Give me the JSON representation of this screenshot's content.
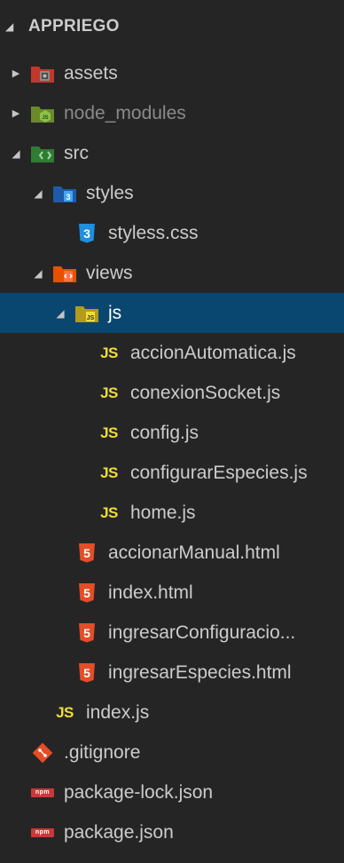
{
  "explorer": {
    "title": "APPRIEGO",
    "items": [
      {
        "label": "assets",
        "icon": "folder-assets-icon",
        "depth": 1,
        "state": "collapsed"
      },
      {
        "label": "node_modules",
        "icon": "folder-node-icon",
        "depth": 1,
        "state": "collapsed",
        "dim": true
      },
      {
        "label": "src",
        "icon": "folder-src-icon",
        "depth": 1,
        "state": "expanded"
      },
      {
        "label": "styles",
        "icon": "folder-styles-icon",
        "depth": 2,
        "state": "expanded"
      },
      {
        "label": "styless.css",
        "icon": "css-file-icon",
        "depth": 3
      },
      {
        "label": "views",
        "icon": "folder-views-icon",
        "depth": 2,
        "state": "expanded"
      },
      {
        "label": "js",
        "icon": "folder-js-icon",
        "depth": 3,
        "state": "expanded",
        "selected": true
      },
      {
        "label": "accionAutomatica.js",
        "icon": "js-file-icon",
        "depth": 4
      },
      {
        "label": "conexionSocket.js",
        "icon": "js-file-icon",
        "depth": 4
      },
      {
        "label": "config.js",
        "icon": "js-file-icon",
        "depth": 4
      },
      {
        "label": "configurarEspecies.js",
        "icon": "js-file-icon",
        "depth": 4
      },
      {
        "label": "home.js",
        "icon": "js-file-icon",
        "depth": 4
      },
      {
        "label": "accionarManual.html",
        "icon": "html-file-icon",
        "depth": 3
      },
      {
        "label": "index.html",
        "icon": "html-file-icon",
        "depth": 3
      },
      {
        "label": "ingresarConfiguracio...",
        "icon": "html-file-icon",
        "depth": 3
      },
      {
        "label": "ingresarEspecies.html",
        "icon": "html-file-icon",
        "depth": 3
      },
      {
        "label": "index.js",
        "icon": "js-file-icon",
        "depth": 2
      },
      {
        "label": ".gitignore",
        "icon": "git-file-icon",
        "depth": 1
      },
      {
        "label": "package-lock.json",
        "icon": "npm-file-icon",
        "depth": 1
      },
      {
        "label": "package.json",
        "icon": "npm-file-icon",
        "depth": 1
      }
    ]
  },
  "badges": {
    "js": "JS",
    "html": "5",
    "css": "3",
    "npm": "npm"
  },
  "colors": {
    "background": "#252526",
    "selection": "#094771",
    "js_yellow": "#f1dd35",
    "html_orange": "#e44d26",
    "css_blue": "#1f8fe0",
    "npm_red": "#cb3837"
  }
}
